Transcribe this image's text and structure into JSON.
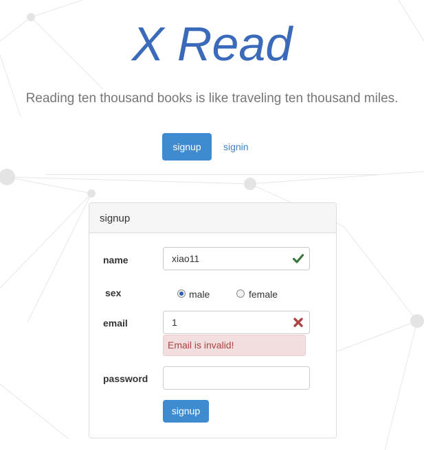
{
  "header": {
    "title": "X Read",
    "tagline": "Reading ten thousand books is like traveling ten thousand miles."
  },
  "nav": {
    "signup_label": "signup",
    "signin_label": "signin"
  },
  "form": {
    "heading": "signup",
    "name_label": "name",
    "name_value": "xiao11",
    "name_status_icon": "check-icon",
    "sex_label": "sex",
    "sex_options": [
      "male",
      "female"
    ],
    "sex_selected": "male",
    "email_label": "email",
    "email_value": "1",
    "email_status_icon": "error-x-icon",
    "email_error": "Email is invalid!",
    "password_label": "password",
    "password_value": "",
    "submit_label": "signup"
  },
  "colors": {
    "title": "#3a6ab9",
    "primary_button": "#3f8bd0",
    "success": "#3c763d",
    "error": "#a94442",
    "error_bg": "#f2dede"
  }
}
